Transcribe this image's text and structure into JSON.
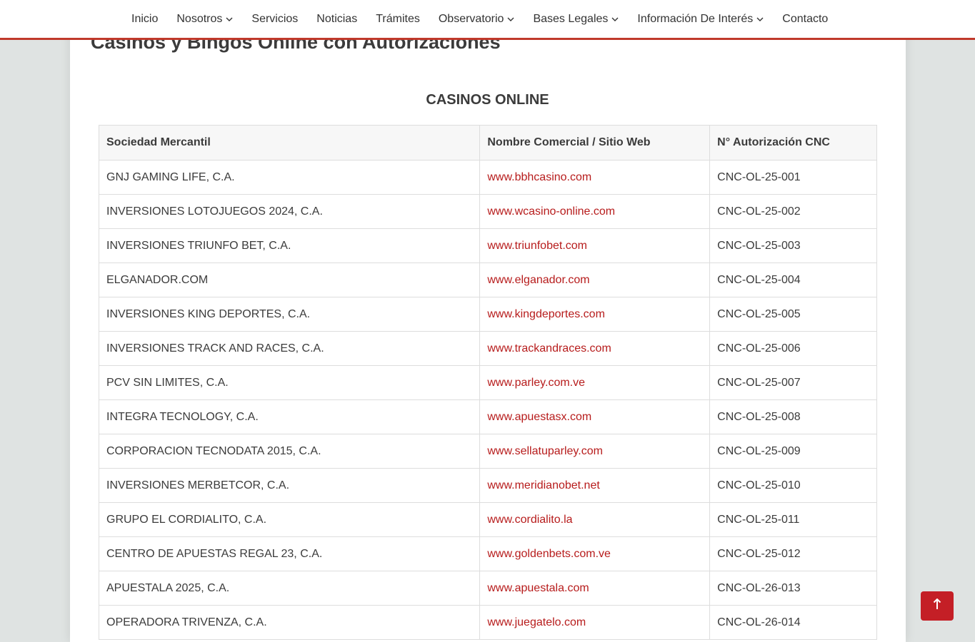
{
  "nav": {
    "items": [
      {
        "label": "Inicio",
        "dropdown": false
      },
      {
        "label": "Nosotros",
        "dropdown": true
      },
      {
        "label": "Servicios",
        "dropdown": false
      },
      {
        "label": "Noticias",
        "dropdown": false
      },
      {
        "label": "Trámites",
        "dropdown": false
      },
      {
        "label": "Observatorio",
        "dropdown": true
      },
      {
        "label": "Bases Legales",
        "dropdown": true
      },
      {
        "label": "Información De Interés",
        "dropdown": true
      },
      {
        "label": "Contacto",
        "dropdown": false
      }
    ]
  },
  "page": {
    "title": "Casinos y Bingos Online con Autorizaciones",
    "section_title": "CASINOS ONLINE"
  },
  "table": {
    "headers": [
      "Sociedad Mercantil",
      "Nombre Comercial / Sitio Web",
      "N° Autorización CNC"
    ],
    "rows": [
      [
        "GNJ GAMING LIFE, C.A.",
        "www.bbhcasino.com",
        "CNC-OL-25-001"
      ],
      [
        "INVERSIONES LOTOJUEGOS 2024, C.A.",
        "www.wcasino-online.com",
        "CNC-OL-25-002"
      ],
      [
        "INVERSIONES TRIUNFO BET, C.A.",
        "www.triunfobet.com",
        "CNC-OL-25-003"
      ],
      [
        "ELGANADOR.COM",
        "www.elganador.com",
        "CNC-OL-25-004"
      ],
      [
        "INVERSIONES KING DEPORTES, C.A.",
        "www.kingdeportes.com",
        "CNC-OL-25-005"
      ],
      [
        "INVERSIONES TRACK AND RACES, C.A.",
        "www.trackandraces.com",
        "CNC-OL-25-006"
      ],
      [
        "PCV SIN LIMITES, C.A.",
        "www.parley.com.ve",
        "CNC-OL-25-007"
      ],
      [
        "INTEGRA TECNOLOGY, C.A.",
        "www.apuestasx.com",
        "CNC-OL-25-008"
      ],
      [
        "CORPORACION TECNODATA 2015, C.A.",
        "www.sellatuparley.com",
        "CNC-OL-25-009"
      ],
      [
        "INVERSIONES MERBETCOR, C.A.",
        "www.meridianobet.net",
        "CNC-OL-25-010"
      ],
      [
        "GRUPO EL CORDIALITO, C.A.",
        "www.cordialito.la",
        "CNC-OL-25-011"
      ],
      [
        "CENTRO DE APUESTAS REGAL 23, C.A.",
        "www.goldenbets.com.ve",
        "CNC-OL-25-012"
      ],
      [
        "APUESTALA 2025, C.A.",
        "www.apuestala.com",
        "CNC-OL-26-013"
      ],
      [
        "OPERADORA TRIVENZA, C.A.",
        "www.juegatelo.com",
        "CNC-OL-26-014"
      ]
    ]
  },
  "icons": {
    "dropdown": "chevron-down-icon",
    "back_to_top": "arrow-up-icon"
  },
  "colors": {
    "accent": "#c0392b",
    "link": "#b71c1c",
    "back_to_top": "#c41f26"
  }
}
